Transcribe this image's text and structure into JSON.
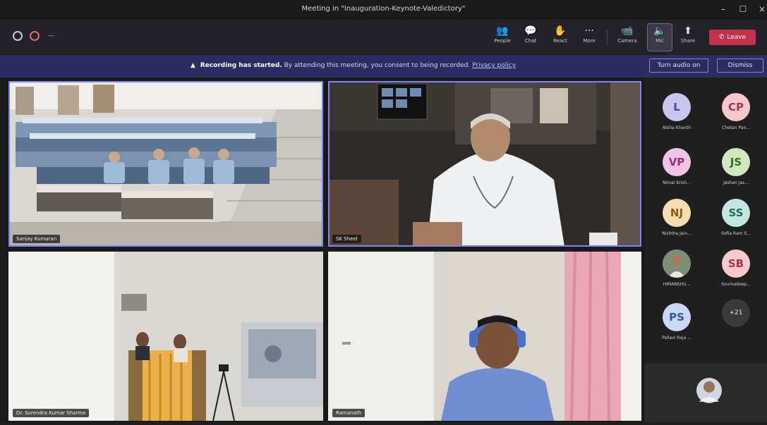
{
  "window": {
    "title": "Meeting in \"Inauguration-Keynote-Valedictory\"",
    "minimize": "–",
    "maximize": "☐",
    "close": "×"
  },
  "toolbar": {
    "timer": "—",
    "buttons": [
      {
        "label": "People",
        "icon": "👥"
      },
      {
        "label": "Chat",
        "icon": "💬"
      },
      {
        "label": "React",
        "icon": "✋"
      },
      {
        "label": "More",
        "icon": "···"
      },
      {
        "label": "Camera",
        "icon": "📹"
      },
      {
        "label": "Mic",
        "icon": "🔈"
      },
      {
        "label": "Share",
        "icon": "⬆"
      }
    ],
    "leave_label": "Leave",
    "leave_icon": "✆"
  },
  "banner": {
    "title": "Recording has started.",
    "text": "By attending this meeting, you consent to being recorded.",
    "link": "Privacy policy",
    "turn_audio_label": "Turn audio on",
    "dismiss_label": "Dismiss"
  },
  "tiles": [
    {
      "name": "Sanjay Kumaran"
    },
    {
      "name": "SK Sheel"
    },
    {
      "name": "Dr. Surendra Kumar Sharma"
    },
    {
      "name": "Ramanath"
    }
  ],
  "participants": [
    {
      "initials": "L",
      "name": "Nisha Khanth",
      "bg": "#c9c7f0",
      "fg": "#4b4a7e"
    },
    {
      "initials": "CP",
      "name": "Chetan Pan...",
      "bg": "#f7c6cf",
      "fg": "#a0384f"
    },
    {
      "initials": "VP",
      "name": "Nimai Krish...",
      "bg": "#f0c4e4",
      "fg": "#92317c"
    },
    {
      "initials": "JS",
      "name": "Jashan Jas...",
      "bg": "#cfe8c0",
      "fg": "#3f6a2a"
    },
    {
      "initials": "NJ",
      "name": "Nishtha Jain...",
      "bg": "#f6ddb0",
      "fg": "#8a5a12"
    },
    {
      "initials": "SS",
      "name": "Sofia Ram S...",
      "bg": "#c3e7e0",
      "fg": "#23695c"
    },
    {
      "initials": "",
      "name": "HIMANSHU...",
      "bg": "#8c8c8c",
      "fg": "#ffffff"
    },
    {
      "initials": "SB",
      "name": "Soumadeep...",
      "bg": "#f8c9cc",
      "fg": "#a8344a"
    },
    {
      "initials": "PS",
      "name": "Pallavi Raja ...",
      "bg": "#cbd8f5",
      "fg": "#3a5595"
    },
    {
      "initials": "+21",
      "name": "",
      "bg": "#3b3a3a",
      "fg": "#e0e0e0"
    }
  ],
  "colors": {
    "accent": "#7f85f5",
    "leave": "#c4314b",
    "banner": "#2d2c62"
  }
}
